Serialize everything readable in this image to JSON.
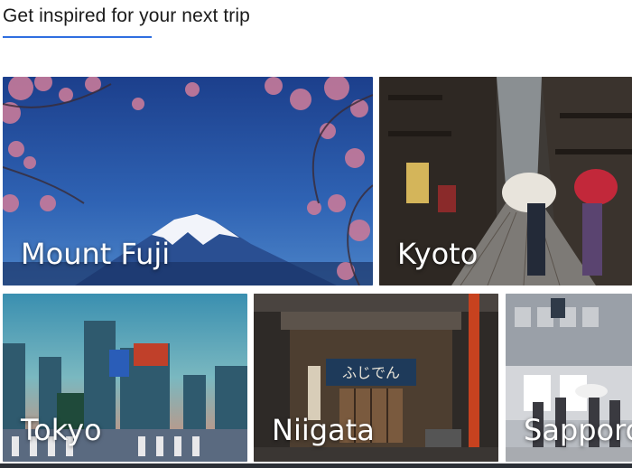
{
  "section": {
    "heading": "Get inspired for your next trip"
  },
  "destinations": [
    {
      "name": "Mount Fuji"
    },
    {
      "name": "Kyoto"
    },
    {
      "name": "Tokyo"
    },
    {
      "name": "Niigata"
    },
    {
      "name": "Sapporo"
    }
  ],
  "colors": {
    "accent": "#2f6fe0",
    "heading_text": "#1a1a1a"
  },
  "scene_signs": {
    "niigata_shop": "ふじでん"
  }
}
